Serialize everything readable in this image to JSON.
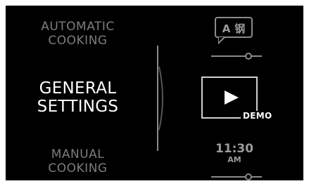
{
  "menu": {
    "automatic_cooking": [
      "AUTOMATIC",
      "COOKING"
    ],
    "general_settings": [
      "GENERAL",
      "SETTINGS"
    ],
    "manual_cooking": [
      "MANUAL",
      "COOKING"
    ]
  },
  "language": {
    "latin_char": "A",
    "chinese_char": "钢",
    "icon": "language-speech-bubble-icon"
  },
  "demo": {
    "label": "DEMO",
    "icon": "play-icon"
  },
  "clock": {
    "time": "11:30",
    "period": "AM"
  },
  "colors": {
    "background": "#000000",
    "active_text": "#ffffff",
    "inactive_text": "#7d7d7d"
  }
}
